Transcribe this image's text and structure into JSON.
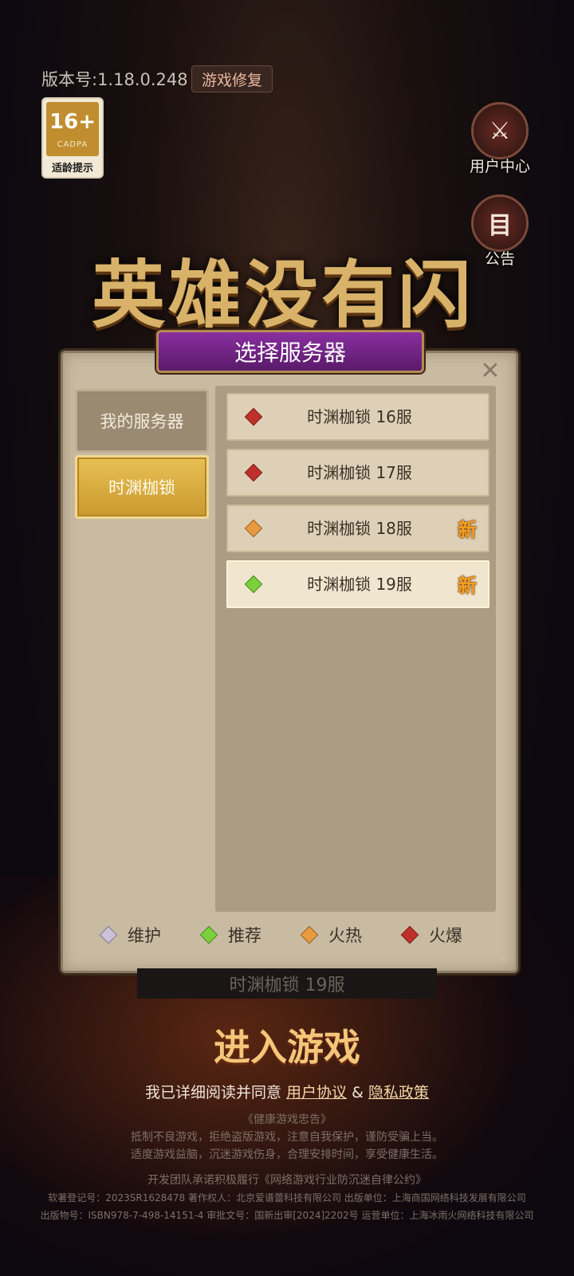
{
  "version_label": "版本号:1.18.0.248",
  "repair_button": "游戏修复",
  "age_rating": {
    "number": "16+",
    "org": "CADPA",
    "tip": "适龄提示"
  },
  "side_buttons": {
    "user_center": "用户中心",
    "notice": "公告"
  },
  "game_title": "英雄没有闪",
  "dialog": {
    "title": "选择服务器",
    "categories": [
      {
        "label": "我的服务器",
        "selected": false
      },
      {
        "label": "时渊枷锁",
        "selected": true
      }
    ],
    "servers": [
      {
        "name": "时渊枷锁 16服",
        "status": "火爆",
        "color": "#c0302a",
        "new": ""
      },
      {
        "name": "时渊枷锁 17服",
        "status": "火爆",
        "color": "#c0302a",
        "new": ""
      },
      {
        "name": "时渊枷锁 18服",
        "status": "火热",
        "color": "#e89a40",
        "new": "新"
      },
      {
        "name": "时渊枷锁 19服",
        "status": "推荐",
        "color": "#7ad03a",
        "new": "新"
      }
    ],
    "legend": [
      {
        "label": "维护",
        "color": "#c9c2d8"
      },
      {
        "label": "推荐",
        "color": "#7ad03a"
      },
      {
        "label": "火热",
        "color": "#e89a40"
      },
      {
        "label": "火爆",
        "color": "#c0302a"
      }
    ]
  },
  "current_server": "时渊枷锁 19服",
  "enter_button": "进入游戏",
  "agreement": {
    "prefix": "我已详细阅读并同意",
    "user_agreement": "用户协议",
    "and": "&",
    "privacy_policy": "隐私政策"
  },
  "footer": {
    "health_title": "《健康游戏忠告》",
    "health_line1": "抵制不良游戏，拒绝盗版游戏，注意自我保护，谨防受骗上当。",
    "health_line2": "适度游戏益脑，沉迷游戏伤身，合理安排时间，享受健康生活。",
    "team_line": "开发团队承诺积极履行《网络游戏行业防沉迷自律公约》",
    "reg_line": "软著登记号：2023SR1628478 著作权人：北京爱谱蕾科技有限公司 出版单位：上海商国网络科技发展有限公司",
    "pub_line": "出版物号：ISBN978-7-498-14151-4 审批文号：国新出审[2024]2202号 运营单位：上海冰雨火网络科技有限公司"
  }
}
